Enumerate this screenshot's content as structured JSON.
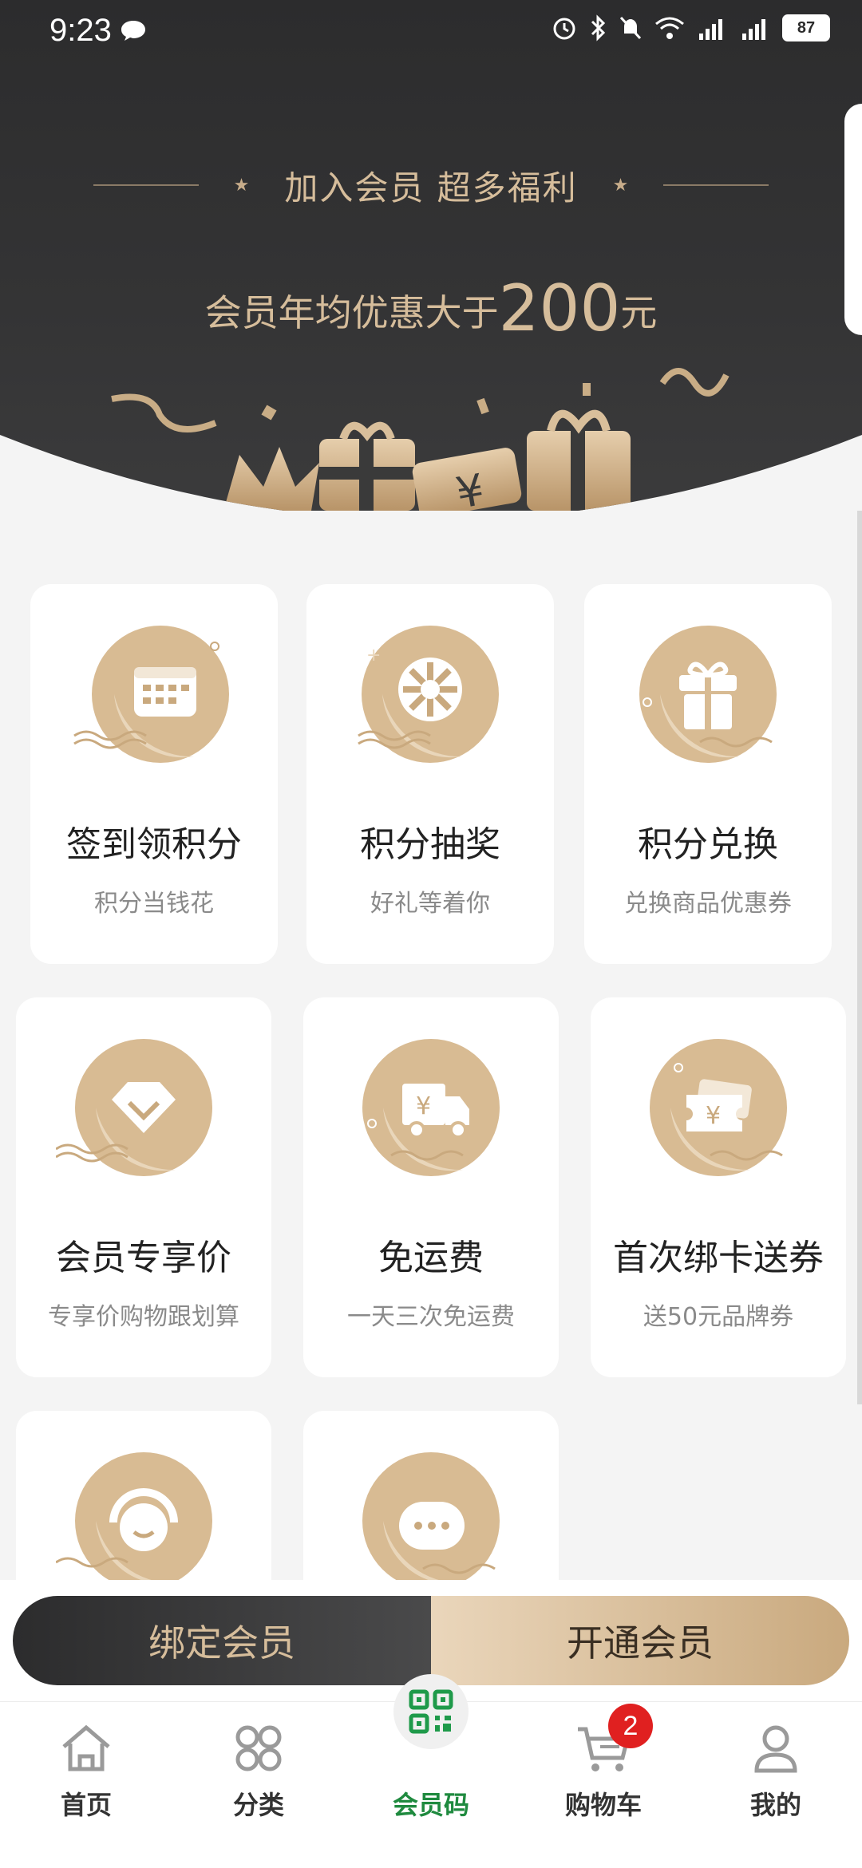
{
  "status_bar": {
    "time": "9:23",
    "battery": "87"
  },
  "hero": {
    "title": "加入会员 超多福利",
    "subtitle_prefix": "会员年均优惠大于",
    "subtitle_amount": "200",
    "subtitle_suffix": "元"
  },
  "benefits": [
    {
      "name": "签到领积分",
      "desc": "积分当钱花",
      "icon": "calendar-icon"
    },
    {
      "name": "积分抽奖",
      "desc": "好礼等着你",
      "icon": "lottery-wheel-icon"
    },
    {
      "name": "积分兑换",
      "desc": "兑换商品优惠券",
      "icon": "gift-icon"
    },
    {
      "name": "会员专享价",
      "desc": "专享价购物跟划算",
      "icon": "diamond-icon"
    },
    {
      "name": "免运费",
      "desc": "一天三次免运费",
      "icon": "delivery-truck-icon"
    },
    {
      "name": "首次绑卡送券",
      "desc": "送50元品牌券",
      "icon": "card-coupon-icon"
    },
    {
      "name": "",
      "desc": "",
      "icon": "customer-service-icon"
    },
    {
      "name": "",
      "desc": "",
      "icon": "chat-bubble-icon"
    }
  ],
  "actions": {
    "bind_label": "绑定会员",
    "open_label": "开通会员"
  },
  "nav": {
    "items": [
      {
        "label": "首页",
        "icon": "home-icon"
      },
      {
        "label": "分类",
        "icon": "category-icon"
      },
      {
        "label": "会员码",
        "icon": "qr-code-icon"
      },
      {
        "label": "购物车",
        "icon": "cart-icon"
      },
      {
        "label": "我的",
        "icon": "profile-icon"
      }
    ],
    "active_index": 2,
    "cart_badge": "2"
  },
  "colors": {
    "gold": "#d6bd9b",
    "dark": "#2c2c2d",
    "active_green": "#1f8a3f"
  }
}
